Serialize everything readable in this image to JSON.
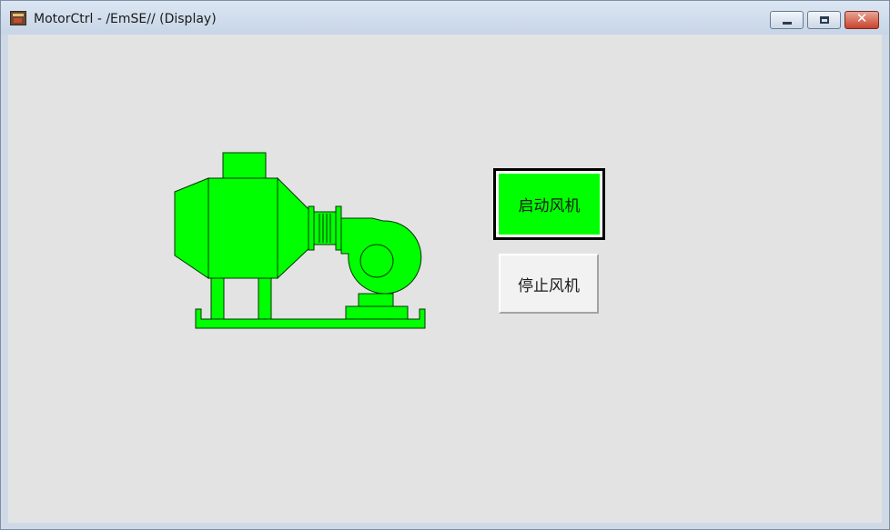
{
  "window": {
    "title": "MotorCtrl - /EmSE// (Display)",
    "controls": {
      "minimize": "minimize-button",
      "maximize": "maximize-button",
      "close": "close-button",
      "close_glyph": "✕"
    }
  },
  "display": {
    "equipment": {
      "name": "fan-motor-graphic",
      "status_color": "#00ff00"
    },
    "start_button": {
      "label": "启动风机",
      "color": "#00ff00"
    },
    "stop_button": {
      "label": "停止风机",
      "color": "#f2f2f2"
    }
  }
}
